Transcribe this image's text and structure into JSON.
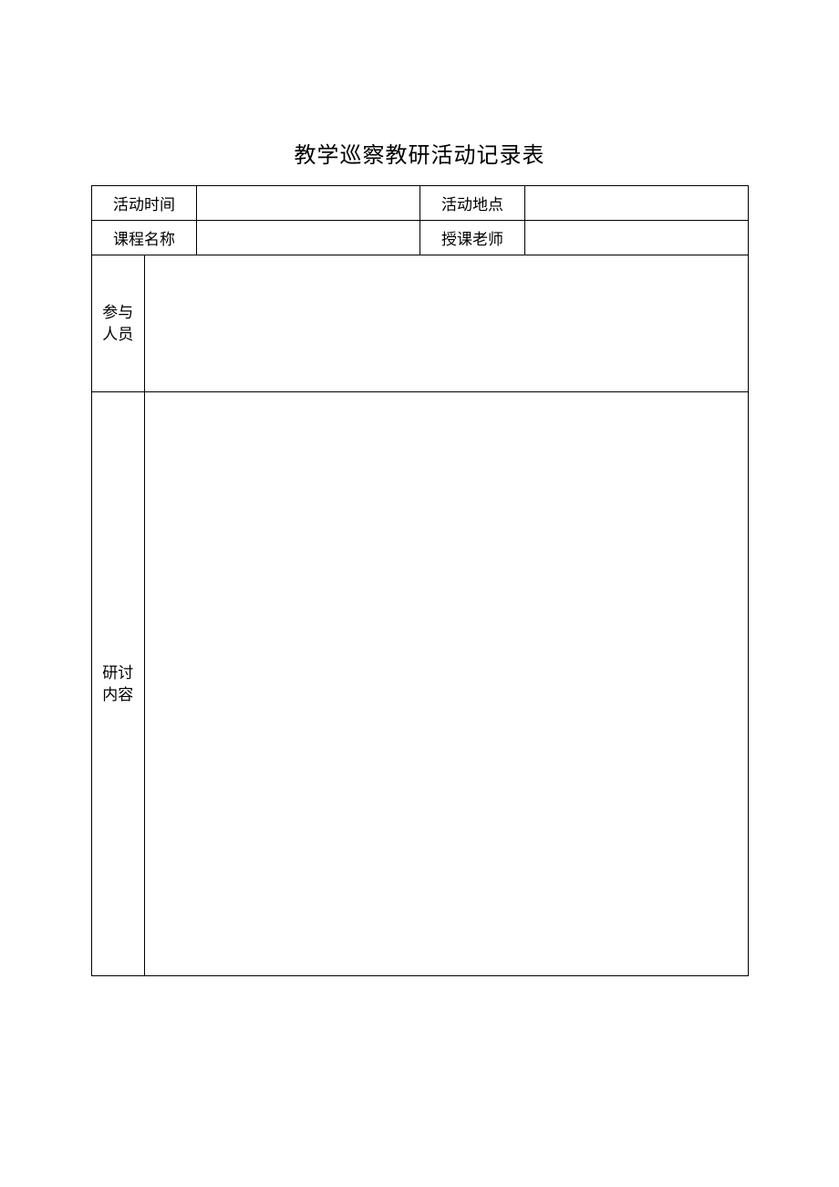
{
  "title": "教学巡察教研活动记录表",
  "labels": {
    "activity_time": "活动时间",
    "activity_location": "活动地点",
    "course_name": "课程名称",
    "instructor": "授课老师",
    "participants": "参与人员",
    "discussion_content": "研讨内容"
  },
  "values": {
    "activity_time": "",
    "activity_location": "",
    "course_name": "",
    "instructor": "",
    "participants": "",
    "discussion_content": ""
  }
}
